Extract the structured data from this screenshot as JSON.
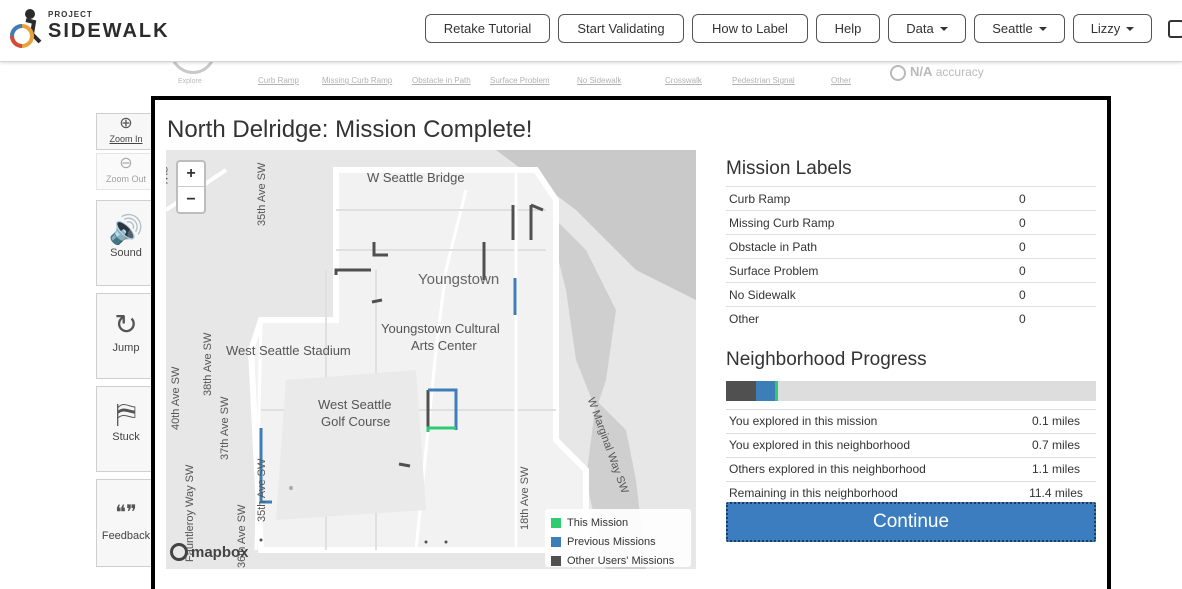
{
  "topbar": {
    "logo_small": "PROJECT",
    "logo_big": "SIDEWALK",
    "buttons": [
      {
        "label": "Retake Tutorial"
      },
      {
        "label": "Start Validating"
      },
      {
        "label": "How to Label"
      },
      {
        "label": "Help"
      },
      {
        "label": "Data"
      },
      {
        "label": "Seattle"
      },
      {
        "label": "Lizzy"
      }
    ]
  },
  "labelbar": {
    "explore": "Explore",
    "items": [
      "Curb Ramp",
      "Missing Curb Ramp",
      "Obstacle in Path",
      "Surface Problem",
      "No Sidewalk",
      "Crosswalk",
      "Pedestrian Signal",
      "Other"
    ],
    "accuracy_value": "N/A",
    "accuracy_label": "accuracy"
  },
  "tools": {
    "zoom_in": "Zoom In",
    "zoom_out": "Zoom Out",
    "sound": "Sound",
    "jump": "Jump",
    "stuck": "Stuck",
    "feedback": "Feedback"
  },
  "modal": {
    "title": "North Delridge: Mission Complete!",
    "map": {
      "zoom_in": "+",
      "zoom_out": "−",
      "labels": {
        "bridge": "W Seattle Bridge",
        "youngstown": "Youngstown",
        "cultural_1": "Youngstown Cultural",
        "cultural_2": "Arts Center",
        "stadium": "West Seattle Stadium",
        "golf_1": "West Seattle",
        "golf_2": "Golf Course",
        "ave35_top": "35th Ave SW",
        "ave38": "38th Ave SW",
        "ave40": "40th Ave SW",
        "ave37": "37th Ave SW",
        "fauntleroy": "Fauntleroy Way SW",
        "ave35_bottom": "35th Ave SW",
        "ave36": "36th Ave SW",
        "marginal": "W Marginal Way SW",
        "ave18": "18th Ave SW",
        "edge_sw": "SW"
      },
      "legend": [
        {
          "label": "This Mission",
          "color": "#2ecc71"
        },
        {
          "label": "Previous Missions",
          "color": "#3d7eb8"
        },
        {
          "label": "Other Users' Missions",
          "color": "#505050"
        }
      ],
      "attribution": "mapbox"
    },
    "mission_labels_title": "Mission Labels",
    "mission_labels": [
      {
        "name": "Curb Ramp",
        "count": "0"
      },
      {
        "name": "Missing Curb Ramp",
        "count": "0"
      },
      {
        "name": "Obstacle in Path",
        "count": "0"
      },
      {
        "name": "Surface Problem",
        "count": "0"
      },
      {
        "name": "No Sidewalk",
        "count": "0"
      },
      {
        "name": "Other",
        "count": "0"
      }
    ],
    "progress_title": "Neighborhood Progress",
    "progress": {
      "others_fraction": 0.08,
      "previous_fraction": 0.05,
      "mission_fraction": 0.008,
      "colors": {
        "others": "#505050",
        "previous": "#3d7eb8",
        "mission": "#2ecc71",
        "remaining": "#dddddd"
      }
    },
    "stats": [
      {
        "label": "You explored in this mission",
        "value": "0.1 miles"
      },
      {
        "label": "You explored in this neighborhood",
        "value": "0.7 miles"
      },
      {
        "label": "Others explored in this neighborhood",
        "value": "1.1 miles"
      },
      {
        "label": "Remaining in this neighborhood",
        "value": "11.4 miles"
      }
    ],
    "continue_label": "Continue"
  }
}
